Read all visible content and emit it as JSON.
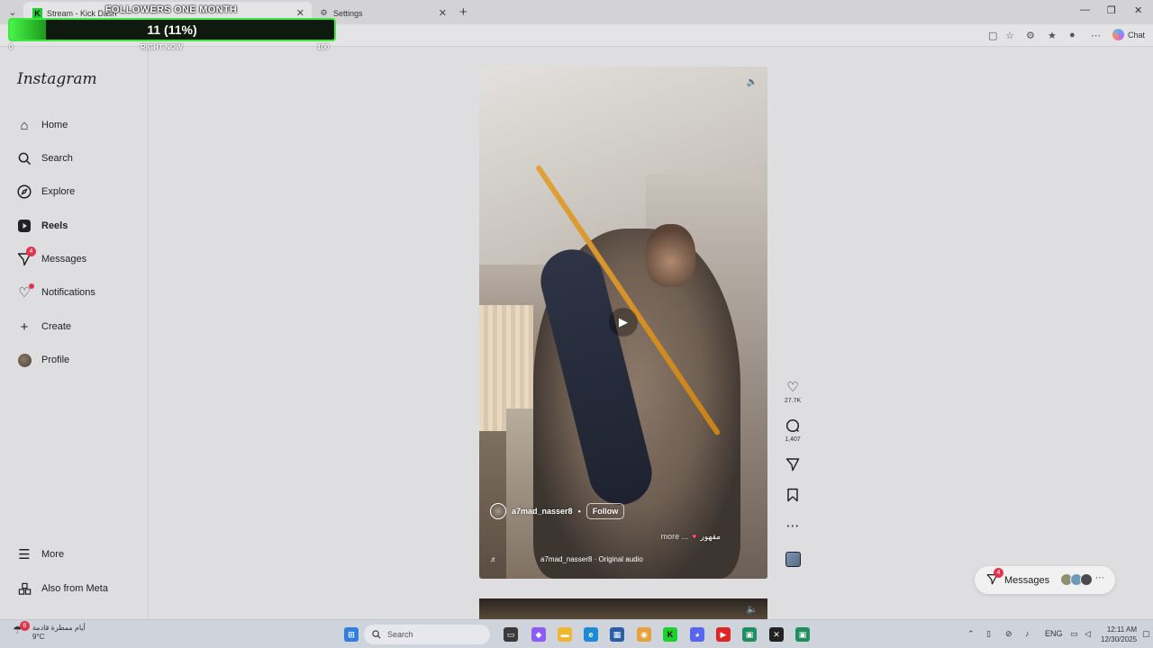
{
  "browser": {
    "tabs": [
      {
        "label": "Stream - Kick Dash",
        "icon": "kick-icon"
      },
      {
        "label": "Settings",
        "icon": "gear-icon"
      }
    ],
    "chat_label": "Chat"
  },
  "overlay": {
    "title": "FOLLOWERS ONE MONTH",
    "value": "11 (11%)",
    "progress": 0.11,
    "min_label": "0",
    "center_label": "RIGHT NOW",
    "max_label": "100"
  },
  "instagram": {
    "logo": "Instagram",
    "nav": [
      {
        "label": "Home",
        "icon": "home-icon"
      },
      {
        "label": "Search",
        "icon": "search-icon"
      },
      {
        "label": "Explore",
        "icon": "compass-icon"
      },
      {
        "label": "Reels",
        "icon": "reels-icon"
      },
      {
        "label": "Messages",
        "icon": "messenger-icon",
        "badge": "4"
      },
      {
        "label": "Notifications",
        "icon": "heart-icon"
      },
      {
        "label": "Create",
        "icon": "plus-icon"
      },
      {
        "label": "Profile",
        "icon": "avatar"
      }
    ],
    "bottom_nav": [
      {
        "label": "More",
        "icon": "menu-icon"
      },
      {
        "label": "Also from Meta",
        "icon": "meta-grid-icon"
      }
    ],
    "reel": {
      "username": "a7mad_nasser8",
      "separator": "•",
      "follow_label": "Follow",
      "caption_more": "more ...",
      "caption_text": "مقهور",
      "audio": "a7mad_nasser8 · Original audio"
    },
    "actions": {
      "likes": "27.7K",
      "comments": "1,407"
    },
    "messages_pill": {
      "label": "Messages",
      "badge": "4"
    }
  },
  "taskbar": {
    "weather_badge": "6",
    "weather_line1": "أيام ممطرة قادمة",
    "weather_line2": "9°C",
    "search_placeholder": "Search",
    "lang": "ENG",
    "time": "12:11 AM",
    "date": "12/30/2025"
  }
}
